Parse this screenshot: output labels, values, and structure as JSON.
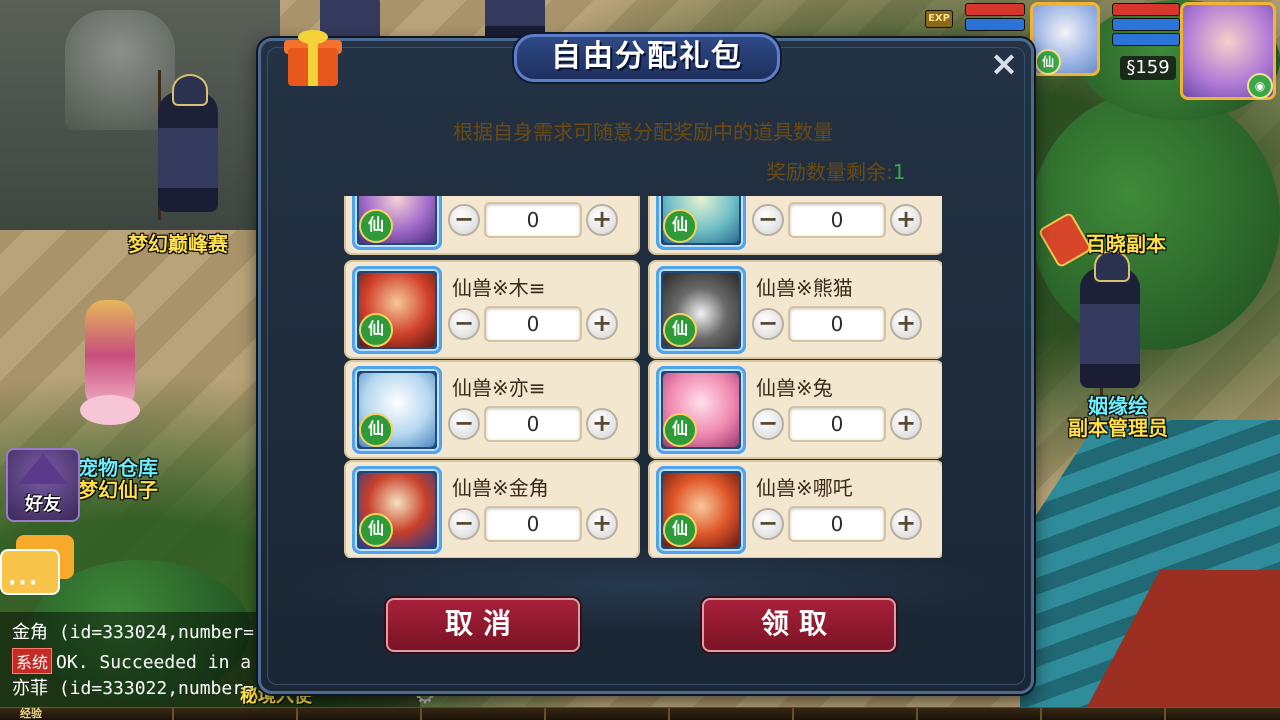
{
  "scene": {
    "npc_labels": {
      "peak_contest": "梦幻巅峰赛",
      "baixiao_dungeon": "百晓副本",
      "pet_storage": "宠物仓库",
      "fairy": "梦幻仙子",
      "marriage_line1": "姻缘绘",
      "marriage_line2": "副本管理员",
      "bottom_npc": "秘境入使"
    }
  },
  "hud": {
    "exp_badge": "EXP",
    "level": "§159",
    "pet_badge": "仙",
    "player_badge": "◉"
  },
  "sidebar": {
    "friend_label": "好友",
    "chat_dots": "···"
  },
  "chat": {
    "lines": [
      {
        "name": "金角",
        "text": "(id=333024,number="
      },
      {
        "tag": "系统",
        "text": "OK. Succeeded in a"
      },
      {
        "name": "亦菲",
        "text": "(id=333022,number="
      }
    ]
  },
  "exp_bar": {
    "label": "经验"
  },
  "dialog": {
    "title": "自由分配礼包",
    "close_icon": "×",
    "description": "根据自身需求可随意分配奖励中的道具数量",
    "remaining_label": "奖励数量剩余:",
    "remaining_value": "1",
    "xian_badge": "仙",
    "minus": "−",
    "plus": "+",
    "items": [
      {
        "name": "",
        "qty": "0"
      },
      {
        "name": "",
        "qty": "0"
      },
      {
        "name": "仙兽※木≡",
        "qty": "0"
      },
      {
        "name": "仙兽※熊猫",
        "qty": "0"
      },
      {
        "name": "仙兽※亦≡",
        "qty": "0"
      },
      {
        "name": "仙兽※兔",
        "qty": "0"
      },
      {
        "name": "仙兽※金角",
        "qty": "0"
      },
      {
        "name": "仙兽※哪吒",
        "qty": "0"
      }
    ],
    "cancel_label": "取消",
    "claim_label": "领取"
  },
  "colors": {
    "dialog_bg": "#1f2c3b",
    "card_bg": "#f3e7cf",
    "button_red": "#8f1a30",
    "text_brown": "#6b4a12",
    "remaining_green": "#3aa648",
    "npc_yellow": "#ffe04a"
  }
}
